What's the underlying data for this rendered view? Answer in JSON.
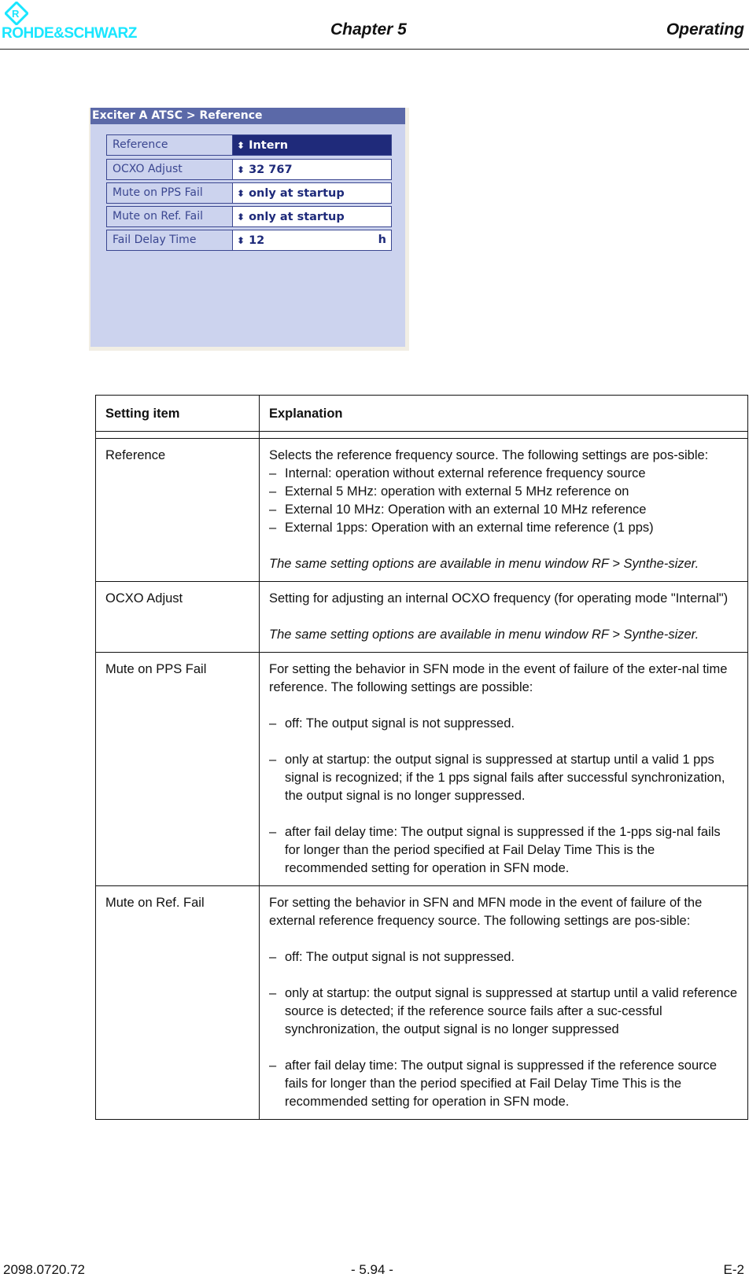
{
  "header": {
    "brand": "ROHDE&SCHWARZ",
    "chapter": "Chapter 5",
    "section": "Operating",
    "brand_color": "#19e6ff"
  },
  "panel": {
    "title": "Exciter A ATSC  > Reference",
    "rows": [
      {
        "label": "Reference",
        "value": "Intern",
        "unit": "",
        "selected": true
      },
      {
        "label": "OCXO Adjust",
        "value": "32 767",
        "unit": "",
        "selected": false
      },
      {
        "label": "Mute on PPS Fail",
        "value": "only at startup",
        "unit": "",
        "selected": false
      },
      {
        "label": "Mute on Ref. Fail",
        "value": "only at startup",
        "unit": "",
        "selected": false
      },
      {
        "label": "Fail Delay Time",
        "value": "12",
        "unit": "h",
        "selected": false
      }
    ],
    "spinner_icon": "up-down-spinner-icon"
  },
  "table": {
    "headers": [
      "Setting item",
      "Explanation"
    ],
    "rows": [
      {
        "item": "Reference",
        "intro": "Selects the reference frequency source. The following settings are pos-sible:",
        "bullets": [
          "Internal: operation without external reference frequency source",
          "External 5 MHz: operation with external 5 MHz reference on",
          "External 10 MHz: Operation with an external 10 MHz reference",
          "External 1pps: Operation with an external time reference (1 pps)"
        ],
        "note": "The same setting options are available in menu window RF > Synthe-sizer."
      },
      {
        "item": "OCXO Adjust",
        "intro": "Setting for adjusting an internal OCXO frequency (for operating mode \"Internal\")",
        "note": "The same setting options are available in menu window RF > Synthe-sizer."
      },
      {
        "item": "Mute on PPS Fail",
        "intro": "For setting the behavior in SFN mode in the event of failure of the exter-nal time reference. The following settings are possible:",
        "bullets": [
          "off: The output signal is not suppressed.",
          "only at startup: the output signal is suppressed at startup until a valid 1 pps signal is recognized; if the 1 pps signal fails after successful synchronization, the output signal is no longer suppressed.",
          "after fail delay time: The output signal is suppressed if the 1-pps sig-nal fails for longer than the period specified at Fail Delay Time This is the recommended setting for operation in SFN mode."
        ]
      },
      {
        "item": "Mute on Ref. Fail",
        "intro": "For setting the behavior in SFN and MFN mode in the event of failure of the external reference frequency source. The following settings are pos-sible:",
        "bullets": [
          "off: The output signal is not suppressed.",
          "only at startup: the output signal is suppressed at startup until a valid reference source is detected; if the reference source fails after a suc-cessful synchronization, the output signal is no longer suppressed",
          "after fail delay time: The output signal is suppressed if the reference source fails for longer than the period specified at Fail Delay Time This is the recommended setting for operation in SFN mode."
        ]
      }
    ]
  },
  "footer": {
    "doc_number": "2098.0720.72",
    "page": "- 5.94 -",
    "edition": "E-2"
  }
}
